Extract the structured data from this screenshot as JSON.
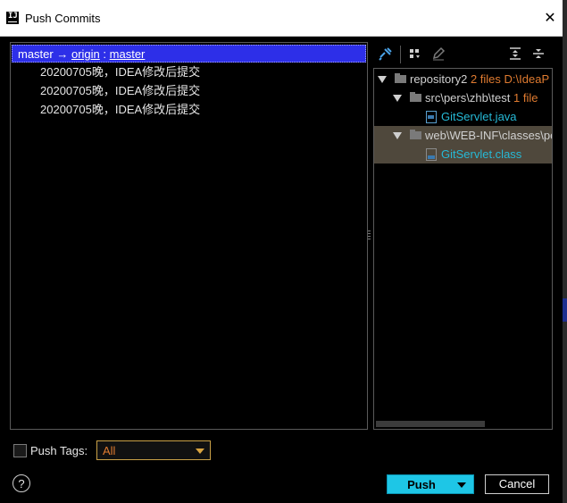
{
  "window": {
    "title": "Push Commits",
    "close_icon": "close-icon"
  },
  "commits": {
    "branch_local": "master",
    "arrow": "→",
    "remote": "origin",
    "separator": ":",
    "branch_remote": "master",
    "items": [
      "20200705晚，IDEA修改后提交",
      "20200705晚，IDEA修改后提交",
      "20200705晚，IDEA修改后提交"
    ]
  },
  "tree": {
    "toolbar_icons": [
      "pin-icon",
      "group-icon",
      "edit-icon",
      "expand-all-icon",
      "collapse-all-icon"
    ],
    "root": {
      "name": "repository2",
      "count": "2 files",
      "path": "D:\\IdeaP"
    },
    "folder1": {
      "name": "src\\pers\\zhb\\test",
      "count": "1 file"
    },
    "file1": {
      "name": "GitServlet.java"
    },
    "folder2": {
      "name": "web\\WEB-INF\\classes\\pe"
    },
    "file2": {
      "name": "GitServlet.class"
    }
  },
  "footer": {
    "push_tags_label": "Push Tags:",
    "tags_value": "All",
    "help": "?",
    "push_label": "Push",
    "cancel_label": "Cancel"
  },
  "colors": {
    "selection": "#2d2fe8",
    "push_button": "#1ec6e6",
    "accent_orange": "#e07b30",
    "file_blue": "#26b9d6"
  }
}
